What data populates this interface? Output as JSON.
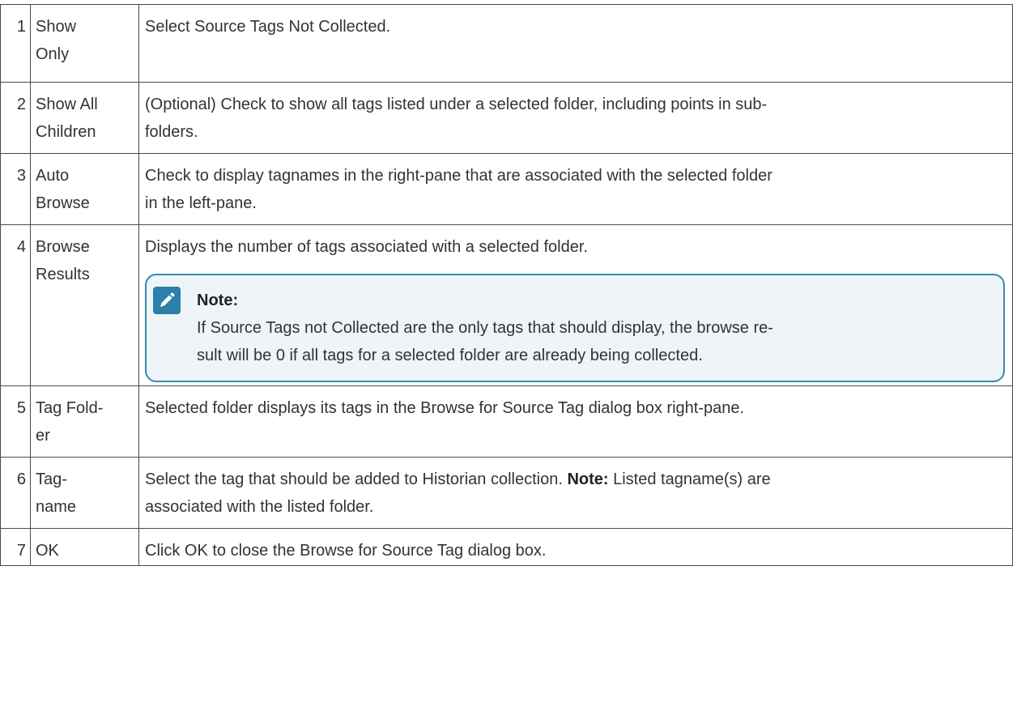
{
  "rows": [
    {
      "num": "1",
      "name_lines": [
        "Show",
        "Only"
      ],
      "desc": "Select Source Tags Not Collected."
    },
    {
      "num": "2",
      "name_lines": [
        "Show All",
        "Children"
      ],
      "desc_lines": [
        "(Optional) Check to show all tags listed under a selected folder, including points in sub-",
        "folders."
      ]
    },
    {
      "num": "3",
      "name_lines": [
        "Auto",
        "Browse"
      ],
      "desc_lines": [
        "Check to display tagnames in the right-pane that are associated with the selected  folder",
        "in the left-pane."
      ]
    },
    {
      "num": "4",
      "name_lines": [
        "Browse",
        "Results"
      ],
      "desc": "Displays the number of tags associated with a selected folder.",
      "note": {
        "icon": "pencil-note-icon",
        "title": "Note:",
        "text_lines": [
          "If Source Tags not Collected are the only tags that should display, the browse re-",
          "sult will be 0 if all tags for a selected folder are already being collected."
        ]
      }
    },
    {
      "num": "5",
      "name_lines": [
        "Tag Fold-",
        "er"
      ],
      "desc": "Selected folder displays its  tags in the Browse for Source Tag dialog box right-pane."
    },
    {
      "num": "6",
      "name_lines": [
        "Tag-",
        "name"
      ],
      "desc_line1_pre": "Select the tag that should be added to Historian collection. ",
      "desc_line1_bold": "Note:",
      "desc_line1_post": " Listed tagname(s) are",
      "desc_line2": "associated with the listed folder."
    },
    {
      "num": "7",
      "name": "OK",
      "desc": "Click OK to close the Browse for Source Tag dialog box."
    }
  ],
  "colors": {
    "border": "#4a4a4a",
    "note_border": "#3a88b0",
    "note_bg": "#eef4f7",
    "note_icon_bg": "#2b7fa8"
  }
}
